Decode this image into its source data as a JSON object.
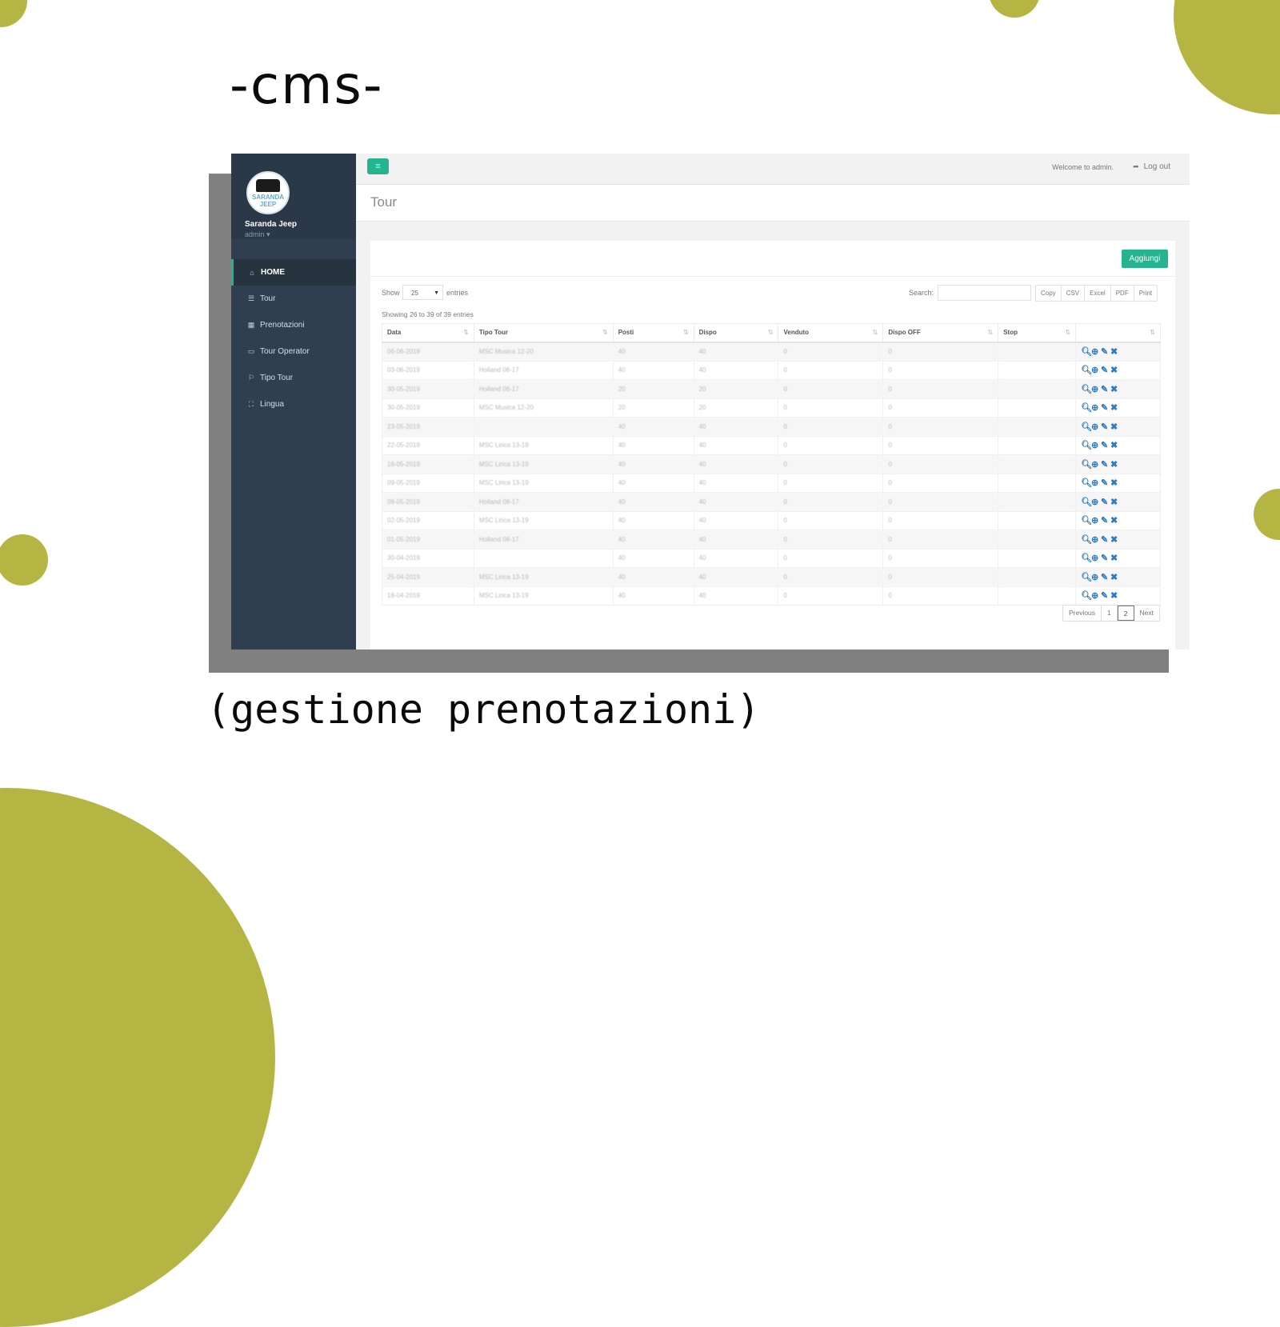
{
  "slide": {
    "title": "-cms-",
    "subtitle": "(gestione prenotazioni)",
    "accent_color": "#b5b543"
  },
  "app": {
    "brand_color": "#26b38f",
    "sidebar": {
      "logo_text": "SARANDA JEEP",
      "user_name": "Saranda Jeep",
      "user_role": "admin ▾",
      "items": [
        {
          "label": "HOME",
          "icon": "home-icon",
          "glyph": "⌂",
          "active": true
        },
        {
          "label": "Tour",
          "icon": "list-icon",
          "glyph": "☰",
          "active": false
        },
        {
          "label": "Prenotazioni",
          "icon": "calendar-icon",
          "glyph": "▦",
          "active": false
        },
        {
          "label": "Tour Operator",
          "icon": "id-card-icon",
          "glyph": "▭",
          "active": false
        },
        {
          "label": "Tipo Tour",
          "icon": "bookmark-icon",
          "glyph": "⚐",
          "active": false
        },
        {
          "label": "Lingua",
          "icon": "language-icon",
          "glyph": "⛶",
          "active": false
        }
      ]
    },
    "topbar": {
      "menu_glyph": "≡",
      "welcome": "Welcome to admin.",
      "logout_glyph": "➦",
      "logout": "Log out"
    },
    "page_title": "Tour",
    "panel": {
      "add_button": "Aggiungi",
      "show_label": "Show",
      "page_length": "25",
      "entries_label": "entries",
      "search_label": "Search:",
      "search_value": "",
      "export_buttons": [
        "Copy",
        "CSV",
        "Excel",
        "PDF",
        "Print"
      ],
      "info": "Showing 26 to 39 of 39 entries",
      "columns": [
        "Data",
        "Tipo Tour",
        "Posti",
        "Dispo",
        "Venduto",
        "Dispo OFF",
        "Stop",
        ""
      ],
      "rows": [
        [
          "06-06-2019",
          "MSC Musica 12-20",
          "40",
          "40",
          "0",
          "0",
          ""
        ],
        [
          "03-06-2019",
          "Holland 08-17",
          "40",
          "40",
          "0",
          "0",
          ""
        ],
        [
          "30-05-2019",
          "Holland 08-17",
          "20",
          "20",
          "0",
          "0",
          ""
        ],
        [
          "30-05-2019",
          "MSC Musica 12-20",
          "20",
          "20",
          "0",
          "0",
          ""
        ],
        [
          "23-05-2019",
          "",
          "40",
          "40",
          "0",
          "0",
          ""
        ],
        [
          "22-05-2019",
          "MSC Lirica 13-19",
          "40",
          "40",
          "0",
          "0",
          ""
        ],
        [
          "16-05-2019",
          "MSC Lirica 13-19",
          "40",
          "40",
          "0",
          "0",
          ""
        ],
        [
          "09-05-2019",
          "MSC Lirica 13-19",
          "40",
          "40",
          "0",
          "0",
          ""
        ],
        [
          "08-05-2019",
          "Holland 08-17",
          "40",
          "40",
          "0",
          "0",
          ""
        ],
        [
          "02-05-2019",
          "MSC Lirica 13-19",
          "40",
          "40",
          "0",
          "0",
          ""
        ],
        [
          "01-05-2019",
          "Holland 08-17",
          "40",
          "40",
          "0",
          "0",
          ""
        ],
        [
          "30-04-2019",
          "",
          "40",
          "40",
          "0",
          "0",
          ""
        ],
        [
          "25-04-2019",
          "MSC Lirica 13-19",
          "40",
          "40",
          "0",
          "0",
          ""
        ],
        [
          "18-04-2019",
          "MSC Lirica 13-19",
          "40",
          "40",
          "0",
          "0",
          ""
        ]
      ],
      "row_actions": [
        {
          "name": "view-icon",
          "glyph": "🔍︎"
        },
        {
          "name": "add-icon",
          "glyph": "⊕"
        },
        {
          "name": "edit-icon",
          "glyph": "✎"
        },
        {
          "name": "delete-icon",
          "glyph": "✖"
        }
      ],
      "pagination": {
        "previous": "Previous",
        "pages": [
          "1",
          "2"
        ],
        "current": "2",
        "next": "Next"
      }
    }
  }
}
